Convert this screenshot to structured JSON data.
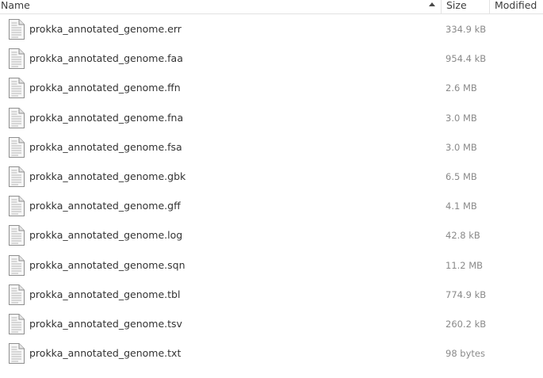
{
  "columns": {
    "name": "Name",
    "size": "Size",
    "modified": "Modified"
  },
  "files": [
    {
      "name": "prokka_annotated_genome.err",
      "size": "334.9 kB",
      "icon": "text-file-icon"
    },
    {
      "name": "prokka_annotated_genome.faa",
      "size": "954.4 kB",
      "icon": "text-file-icon"
    },
    {
      "name": "prokka_annotated_genome.ffn",
      "size": "2.6 MB",
      "icon": "text-file-icon"
    },
    {
      "name": "prokka_annotated_genome.fna",
      "size": "3.0 MB",
      "icon": "text-file-icon"
    },
    {
      "name": "prokka_annotated_genome.fsa",
      "size": "3.0 MB",
      "icon": "text-file-icon"
    },
    {
      "name": "prokka_annotated_genome.gbk",
      "size": "6.5 MB",
      "icon": "text-file-icon"
    },
    {
      "name": "prokka_annotated_genome.gff",
      "size": "4.1 MB",
      "icon": "text-file-icon"
    },
    {
      "name": "prokka_annotated_genome.log",
      "size": "42.8 kB",
      "icon": "text-file-icon"
    },
    {
      "name": "prokka_annotated_genome.sqn",
      "size": "11.2 MB",
      "icon": "text-file-icon"
    },
    {
      "name": "prokka_annotated_genome.tbl",
      "size": "774.9 kB",
      "icon": "text-file-icon"
    },
    {
      "name": "prokka_annotated_genome.tsv",
      "size": "260.2 kB",
      "icon": "text-file-icon"
    },
    {
      "name": "prokka_annotated_genome.txt",
      "size": "98 bytes",
      "icon": "text-file-icon"
    }
  ]
}
